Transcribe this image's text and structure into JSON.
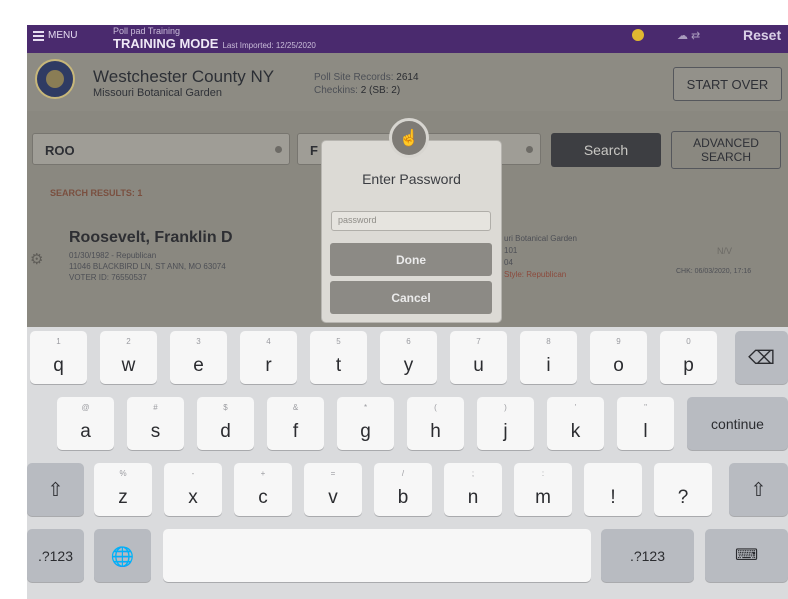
{
  "topbar": {
    "menu_label": "MENU",
    "subtitle": "Poll pad Training",
    "mode": "TRAINING MODE",
    "last_imported": "Last Imported: 12/25/2020",
    "reset_label": "Reset"
  },
  "header": {
    "county": "Westchester County NY",
    "site": "Missouri Botanical Garden",
    "poll_site_records_label": "Poll Site Records:",
    "poll_site_records_value": "2614",
    "checkins_label": "Checkins:",
    "checkins_value": "2 (SB: 2)",
    "start_over_label": "START OVER"
  },
  "search": {
    "last_name_value": "ROO",
    "first_name_value": "F",
    "search_label": "Search",
    "advanced_line1": "ADVANCED",
    "advanced_line2": "SEARCH",
    "results_label": "SEARCH RESULTS: 1"
  },
  "voter": {
    "name": "Roosevelt, Franklin D",
    "dob_party": "01/30/1982 - Republican",
    "address": "11046 BLACKBIRD LN, ST ANN, MO 63074",
    "voter_id": "VOTER ID: 76550537",
    "site_partial": "uri Botanical Garden",
    "precinct_partial": "101",
    "split_partial": "04",
    "ballot_partial": "Style: Republican",
    "status": "N/V",
    "checkin": "CHK: 06/03/2020, 17:16"
  },
  "dialog": {
    "title": "Enter Password",
    "placeholder": "password",
    "done_label": "Done",
    "cancel_label": "Cancel"
  },
  "keyboard": {
    "row1": [
      {
        "main": "q",
        "alt": "1"
      },
      {
        "main": "w",
        "alt": "2"
      },
      {
        "main": "e",
        "alt": "3"
      },
      {
        "main": "r",
        "alt": "4"
      },
      {
        "main": "t",
        "alt": "5"
      },
      {
        "main": "y",
        "alt": "6"
      },
      {
        "main": "u",
        "alt": "7"
      },
      {
        "main": "i",
        "alt": "8"
      },
      {
        "main": "o",
        "alt": "9"
      },
      {
        "main": "p",
        "alt": "0"
      }
    ],
    "row2": [
      {
        "main": "a",
        "alt": "@"
      },
      {
        "main": "s",
        "alt": "#"
      },
      {
        "main": "d",
        "alt": "$"
      },
      {
        "main": "f",
        "alt": "&"
      },
      {
        "main": "g",
        "alt": "*"
      },
      {
        "main": "h",
        "alt": "("
      },
      {
        "main": "j",
        "alt": ")"
      },
      {
        "main": "k",
        "alt": "'"
      },
      {
        "main": "l",
        "alt": "\""
      }
    ],
    "row3": [
      {
        "main": "z",
        "alt": "%"
      },
      {
        "main": "x",
        "alt": "-"
      },
      {
        "main": "c",
        "alt": "+"
      },
      {
        "main": "v",
        "alt": "="
      },
      {
        "main": "b",
        "alt": "/"
      },
      {
        "main": "n",
        "alt": ";"
      },
      {
        "main": "m",
        "alt": ":"
      },
      {
        "main": "!",
        "alt": ""
      },
      {
        "main": "?",
        "alt": ""
      }
    ],
    "continue_label": "continue",
    "numbers_label": ".?123",
    "icons": {
      "backspace": "backspace-icon",
      "shift": "shift-icon",
      "globe": "globe-icon",
      "dismiss": "keyboard-dismiss-icon"
    }
  },
  "colors": {
    "topbar": "#4a2a6e",
    "keyboard": "#dadbdd",
    "search_button": "#3d3e42"
  }
}
